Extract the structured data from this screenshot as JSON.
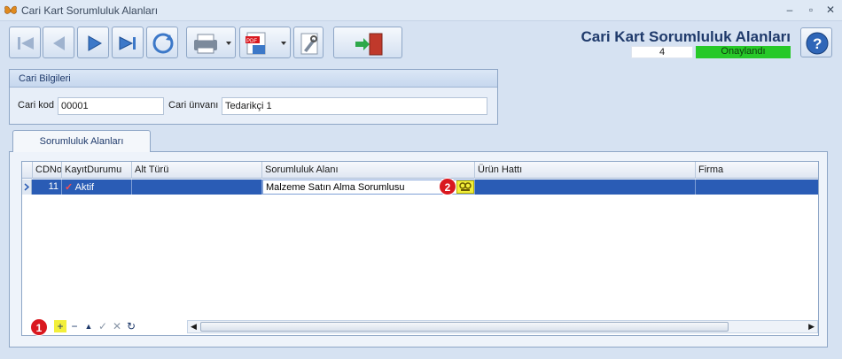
{
  "window": {
    "title": "Cari Kart Sorumluluk Alanları",
    "controls": [
      "minimize-icon",
      "maximize-icon",
      "close-icon"
    ]
  },
  "toolbar": {
    "buttons": [
      "first-record-icon",
      "prev-record-icon",
      "next-record-icon",
      "last-record-icon",
      "refresh-icon",
      "print-icon",
      "pdf-export-icon",
      "tools-icon",
      "exit-door-icon"
    ]
  },
  "header": {
    "form_title": "Cari Kart Sorumluluk Alanları",
    "record_no": "4",
    "status": "Onaylandı",
    "status_color": "#27c928"
  },
  "cari_bilgileri": {
    "title": "Cari Bilgileri",
    "cari_kod_label": "Cari kod",
    "cari_kod_value": "00001",
    "cari_unvani_label": "Cari ünvanı",
    "cari_unvani_value": "Tedarikçi 1"
  },
  "tabs": [
    {
      "label": "Sorumluluk Alanları",
      "active": true
    }
  ],
  "grid": {
    "columns": [
      "CDNo",
      "KayıtDurumu",
      "Alt Türü",
      "Sorumluluk Alanı",
      "Ürün Hattı",
      "Firma"
    ],
    "rows": [
      {
        "cdno": "11",
        "kayit_durumu": "Aktif",
        "alt_turu": "",
        "sorumluluk_alani": "Malzeme Satın Alma Sorumlusu",
        "urun_hatti": "",
        "firma": ""
      }
    ],
    "selected_row_color": "#2a5cb5",
    "navigator": [
      "add-icon",
      "remove-icon",
      "move-up-icon",
      "post-icon",
      "cancel-icon",
      "refresh-icon"
    ]
  },
  "annotations": {
    "badge1": "1",
    "badge2": "2",
    "badge_color": "#d9181f"
  }
}
